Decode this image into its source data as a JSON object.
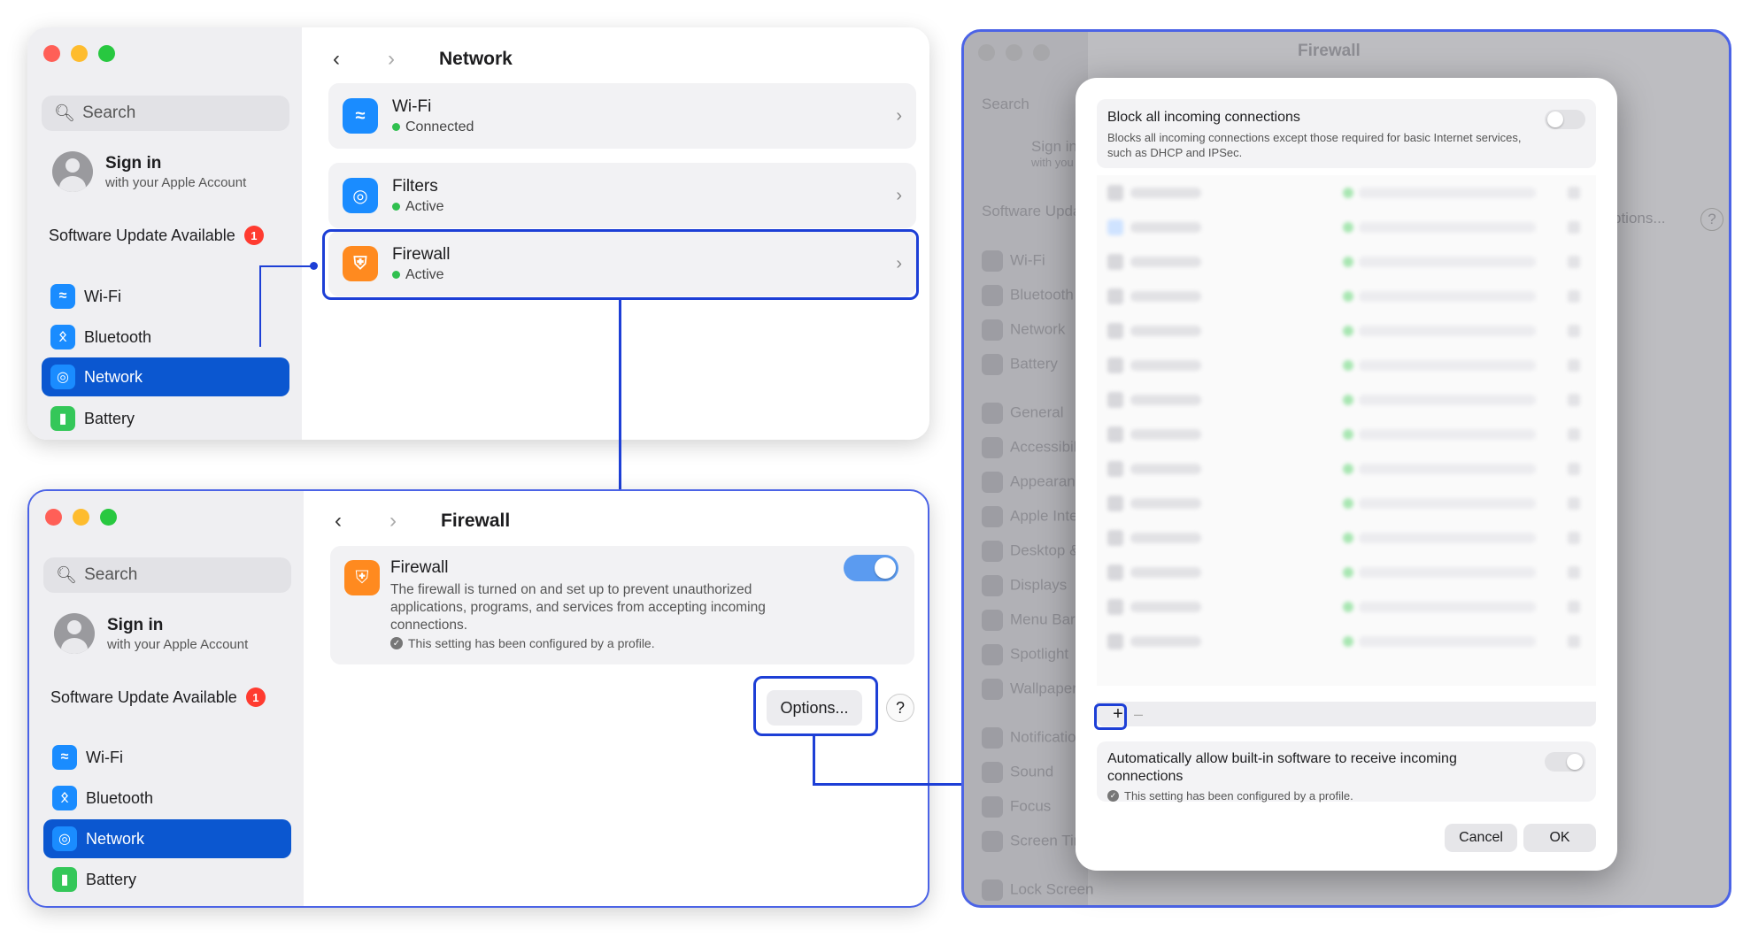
{
  "common": {
    "search_placeholder": "Search",
    "signin_title": "Sign in",
    "signin_sub": "with your Apple Account",
    "update_label": "Software Update Available",
    "update_count": "1",
    "sidebar_items": [
      "Wi-Fi",
      "Bluetooth",
      "Network",
      "Battery"
    ]
  },
  "network_window": {
    "title": "Network",
    "rows": [
      {
        "label": "Wi-Fi",
        "status": "Connected"
      },
      {
        "label": "Filters",
        "status": "Active"
      },
      {
        "label": "Firewall",
        "status": "Active"
      }
    ]
  },
  "firewall_window": {
    "title": "Firewall",
    "card_title": "Firewall",
    "card_desc": "The firewall is turned on and set up to prevent unauthorized applications, programs, and services from accepting incoming connections.",
    "profile_note": "This setting has been configured by a profile.",
    "toggle_on": true,
    "options_label": "Options...",
    "help_label": "?"
  },
  "background_window": {
    "title": "Firewall",
    "search": "Search",
    "signin": "Sign in",
    "signin_sub": "with you",
    "update": "Software Upda",
    "items": [
      "Wi-Fi",
      "Bluetooth",
      "Network",
      "Battery",
      "General",
      "Accessibili",
      "Appearanc",
      "Apple Inte",
      "Desktop &",
      "Displays",
      "Menu Bar",
      "Spotlight",
      "Wallpaper",
      "Notificatio",
      "Sound",
      "Focus",
      "Screen Tir",
      "Lock Screen"
    ],
    "options_partial": "ptions...",
    "help": "?"
  },
  "sheet": {
    "block_title": "Block all incoming connections",
    "block_desc": "Blocks all incoming connections except those required for basic Internet services, such as DHCP and IPSec.",
    "add_label": "+",
    "remove_label": "–",
    "auto_title": "Automatically allow built-in software to receive incoming connections",
    "profile_note": "This setting has been configured by a profile.",
    "cancel_label": "Cancel",
    "ok_label": "OK"
  },
  "colors": {
    "accent": "#0b57d0",
    "highlight": "#1d3fd6",
    "toggle_on": "#5b9bf0",
    "status_dot": "#30c04f"
  }
}
